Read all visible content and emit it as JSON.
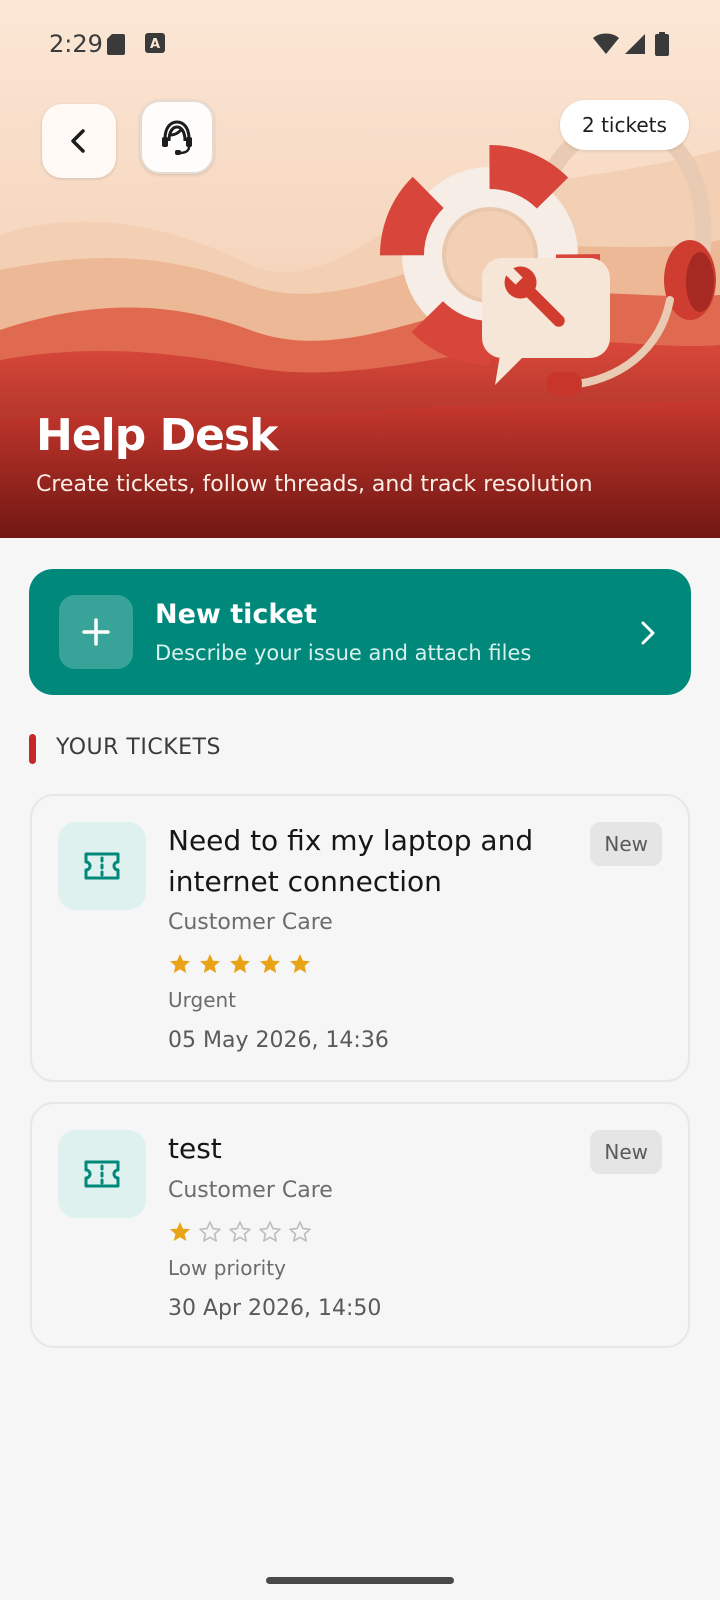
{
  "status_bar": {
    "time": "2:29",
    "icons": [
      "sd-card-icon",
      "a-keyboard-icon",
      "wifi-icon",
      "signal-icon",
      "battery-icon"
    ]
  },
  "header": {
    "back_icon": "chevron-left-icon",
    "agent_icon": "support-agent-icon",
    "tickets_count": "2 tickets",
    "title": "Help Desk",
    "subtitle": "Create tickets, follow threads, and track resolution"
  },
  "new_ticket": {
    "icon": "plus-icon",
    "title": "New ticket",
    "subtitle": "Describe your issue and attach files",
    "chevron_icon": "chevron-right-icon",
    "color": "#00897b"
  },
  "section": {
    "title": "YOUR TICKETS",
    "accent": "#c62828"
  },
  "tickets": [
    {
      "icon": "ticket-icon",
      "title": "Need to fix my laptop and internet connection",
      "department": "Customer Care",
      "rating": 5,
      "rating_max": 5,
      "priority": "Urgent",
      "date": "05 May 2026, 14:36",
      "status": "New"
    },
    {
      "icon": "ticket-icon",
      "title": "test",
      "department": "Customer Care",
      "rating": 1,
      "rating_max": 5,
      "priority": "Low priority",
      "date": "30 Apr 2026, 14:50",
      "status": "New"
    }
  ],
  "colors": {
    "star_filled": "#e8a317",
    "star_empty": "#bdbdbd",
    "hero_red": "#b3271f",
    "hero_cream": "#fbe7d6"
  }
}
